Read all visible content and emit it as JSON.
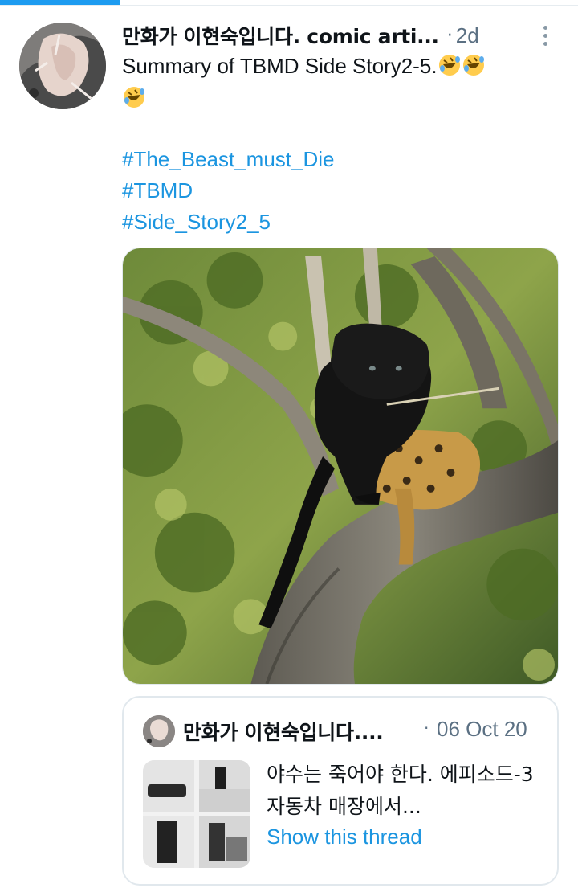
{
  "tweet": {
    "author_name": "만화가 이현숙입니다. comic arti...",
    "separator": "·",
    "time": "2d",
    "more_icon": "more-vertical-icon",
    "text": "Summary of TBMD Side Story2-5.",
    "emoji": "rolling-on-floor-laughing-emoji",
    "hashtags": [
      "#The_Beast_must_Die",
      "#TBMD",
      "#Side_Story2_5"
    ],
    "media_description_icon": "photo-black-panther-with-leopard-in-tree"
  },
  "quote": {
    "author_name": "만화가 이현숙입니다....",
    "separator": "·",
    "date": "06 Oct 20",
    "text": "야수는 죽어야 한다. 에피소드-3 자동차 매장에서...",
    "show_thread": "Show this thread"
  },
  "colors": {
    "link": "#1b95e0",
    "muted": "#5b7083",
    "accent": "#1d9bf0",
    "border": "#e1e8ed"
  }
}
